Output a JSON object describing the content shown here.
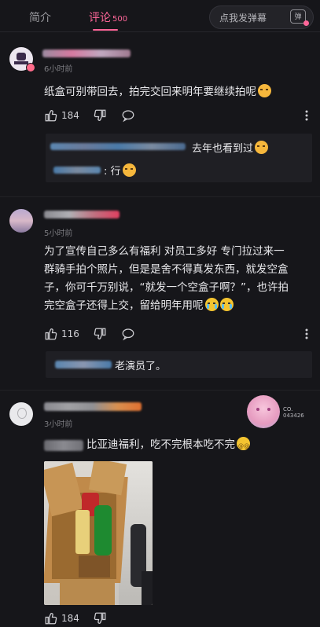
{
  "tabs": {
    "intro_label": "简介",
    "comments_label": "评论",
    "comments_count": "500",
    "danmaku_placeholder": "点我发弹幕",
    "danmaku_button": "弹"
  },
  "comments": [
    {
      "time": "6小时前",
      "text": "纸盒可别带回去，拍完交回来明年要继续拍呢",
      "likes": "184",
      "replies": [
        {
          "text": "去年也看到过"
        },
        {
          "text": "行"
        }
      ]
    },
    {
      "time": "5小时前",
      "text_lines": [
        "为了宣传自己多么有福利 对员工多好 专门拉过来一",
        "群骑手拍个照片，但是是舍不得真发东西，就发空盒",
        "子，你可千万别说，“就发一个空盒子啊？”，也许拍",
        "完空盒子还得上交，留给明年用呢"
      ],
      "likes": "116",
      "replies": [
        {
          "text": "老演员了。"
        }
      ]
    },
    {
      "time": "3小时前",
      "badge_text": [
        "CO.",
        "043426"
      ],
      "text": "比亚迪福利，吃不完根本吃不完",
      "likes": "184"
    }
  ],
  "colors": {
    "accent": "#ff6699",
    "background": "#16161a"
  },
  "icons": [
    "like-icon",
    "dislike-icon",
    "reply-icon",
    "more-icon",
    "danmaku-icon"
  ]
}
